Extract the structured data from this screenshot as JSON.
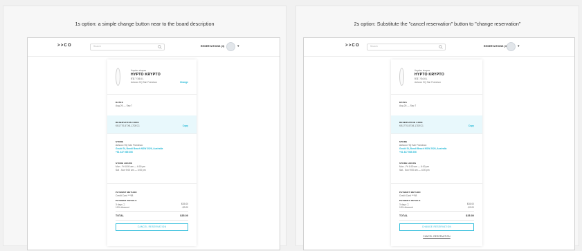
{
  "options": {
    "left_caption": "1s option: a simple change button near to the board description",
    "right_caption": "2s option: Substitute the \"cancel reservation\" button to \"change reservation\""
  },
  "header": {
    "logo": ">>CO",
    "search_placeholder": "Search",
    "reservations_label": "RESERVATIONS (3)"
  },
  "product": {
    "brand": "Hayden shapes",
    "name": "HYPTO KRYPTO",
    "size": "5'11\" / 34.4 L",
    "location": "Awsuco HQ San Francisco",
    "change_link": "Change"
  },
  "dates": {
    "label": "DATES",
    "value": "Aug 26 — Sep 7"
  },
  "reservation_code": {
    "label": "RESERVATION CODE",
    "value": "KB17TS-5TX8-17DEC1",
    "copy_link": "Copy"
  },
  "store": {
    "label": "STORE",
    "name": "Awsuco HQ San Francisco",
    "address": "Gould St, Bondi Beach NSW 2026, Australia",
    "phone": "+61 437 985 206"
  },
  "store_hours": {
    "label": "STORE HOURS",
    "weekday": "Mon - Fri    8:00 am — 6:00 pm",
    "weekend": "Sat - Sun    9:00 am — 4:00 pm"
  },
  "payment": {
    "method_label": "PAYMENT METHOD",
    "method_value": "Credit Card ***58",
    "details_label": "PAYMENT DETAILS",
    "days_label": "3 days ⓘ",
    "days_amount": "$35.00",
    "discount_label": "10% discount",
    "discount_amount": "-$3.00",
    "total_label": "TOTAL",
    "total_amount": "$35.00"
  },
  "actions": {
    "cancel_reservation": "CANCEL RESERVATION",
    "change_reservation": "CHANGE RESERVATION",
    "cancel_reservation_link": "CANCEL RESERVATION"
  },
  "colors": {
    "accent": "#23b8d6",
    "highlight_bg": "#e8f8fc"
  }
}
